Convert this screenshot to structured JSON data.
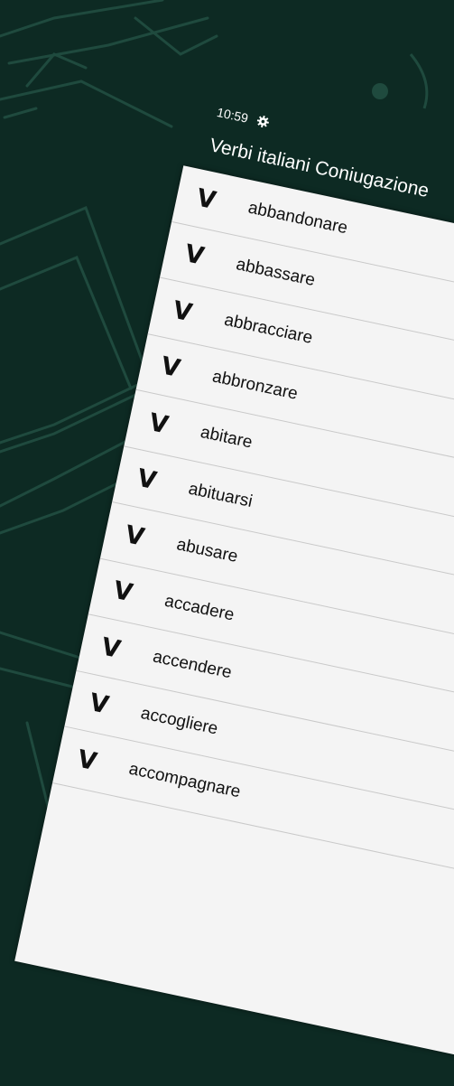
{
  "status_bar": {
    "time": "10:59",
    "settings_icon": "gear-icon"
  },
  "app_bar": {
    "title": "Verbi italiani Coniugazione"
  },
  "verbs": [
    {
      "mark": "V",
      "label": "abbandonare"
    },
    {
      "mark": "V",
      "label": "abbassare"
    },
    {
      "mark": "V",
      "label": "abbracciare"
    },
    {
      "mark": "V",
      "label": "abbronzare"
    },
    {
      "mark": "V",
      "label": "abitare"
    },
    {
      "mark": "V",
      "label": "abituarsi"
    },
    {
      "mark": "V",
      "label": "abusare"
    },
    {
      "mark": "V",
      "label": "accadere"
    },
    {
      "mark": "V",
      "label": "accendere"
    },
    {
      "mark": "V",
      "label": "accogliere"
    },
    {
      "mark": "V",
      "label": "accompagnare"
    }
  ],
  "colors": {
    "background": "#0d2a23",
    "sketch_lines": "#1f4a3e",
    "list_background": "#f4f4f4",
    "text": "#111111"
  }
}
